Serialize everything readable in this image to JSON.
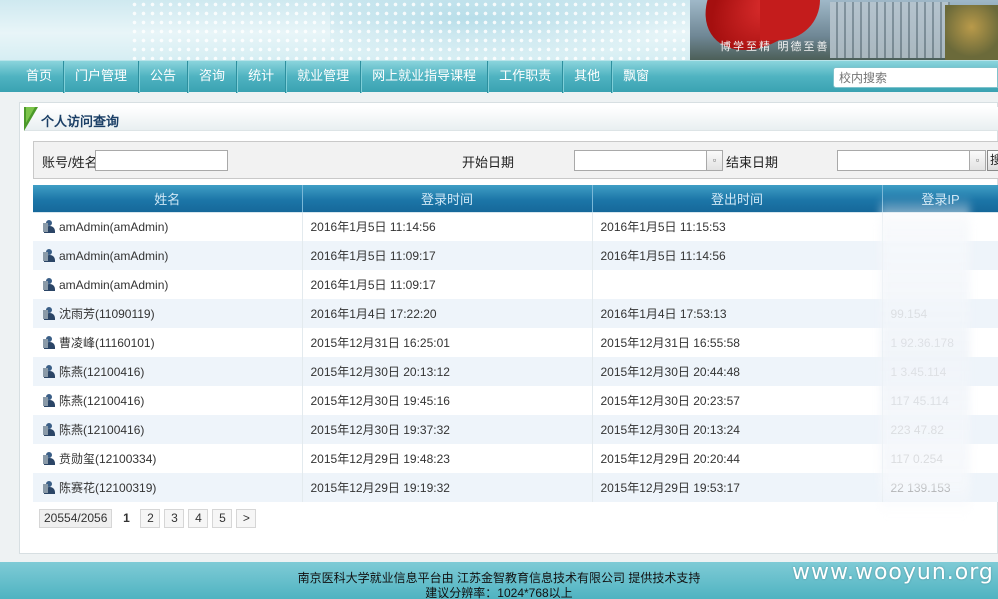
{
  "banner": {
    "calligraphy": "博学至精  明德至善"
  },
  "nav": {
    "items": [
      "首页",
      "门户管理",
      "公告",
      "咨询",
      "统计",
      "就业管理",
      "网上就业指导课程",
      "工作职责",
      "其他",
      "飘窗"
    ],
    "search_placeholder": "校内搜索"
  },
  "panel": {
    "title": "个人访问查询"
  },
  "filter": {
    "account_label": "账号/姓名",
    "account_value": "",
    "start_label": "开始日期",
    "start_value": "",
    "end_label": "结束日期",
    "end_value": "",
    "search_button": "搜"
  },
  "table": {
    "headers": [
      "姓名",
      "登录时间",
      "登出时间",
      "登录IP"
    ],
    "rows": [
      {
        "name": "amAdmin(amAdmin)",
        "login": "2016年1月5日 11:14:56",
        "logout": "2016年1月5日 11:15:53",
        "ip": ""
      },
      {
        "name": "amAdmin(amAdmin)",
        "login": "2016年1月5日 11:09:17",
        "logout": "2016年1月5日 11:14:56",
        "ip": ""
      },
      {
        "name": "amAdmin(amAdmin)",
        "login": "2016年1月5日 11:09:17",
        "logout": "",
        "ip": ""
      },
      {
        "name": "沈雨芳(11090119)",
        "login": "2016年1月4日 17:22:20",
        "logout": "2016年1月4日 17:53:13",
        "ip": "99.154"
      },
      {
        "name": "曹凌峰(11160101)",
        "login": "2015年12月31日 16:25:01",
        "logout": "2015年12月31日 16:55:58",
        "ip": "1    92.36.178"
      },
      {
        "name": "陈燕(12100416)",
        "login": "2015年12月30日 20:13:12",
        "logout": "2015年12月30日 20:44:48",
        "ip": "1    3.45.114"
      },
      {
        "name": "陈燕(12100416)",
        "login": "2015年12月30日 19:45:16",
        "logout": "2015年12月30日 20:23:57",
        "ip": "117    45.114"
      },
      {
        "name": "陈燕(12100416)",
        "login": "2015年12月30日 19:37:32",
        "logout": "2015年12月30日 20:13:24",
        "ip": "223    47.82"
      },
      {
        "name": "贲勋玺(12100334)",
        "login": "2015年12月29日 19:48:23",
        "logout": "2015年12月29日 20:20:44",
        "ip": "117    0.254"
      },
      {
        "name": "陈赛花(12100319)",
        "login": "2015年12月29日 19:19:32",
        "logout": "2015年12月29日 19:53:17",
        "ip": "22    139.153"
      }
    ]
  },
  "pager": {
    "info": "20554/2056",
    "pages": [
      "1",
      "2",
      "3",
      "4",
      "5",
      ">"
    ],
    "current": "1"
  },
  "footer": {
    "line1": "南京医科大学就业信息平台由 江苏金智教育信息技术有限公司 提供技术支持",
    "line2": "建议分辨率：1024*768以上"
  },
  "watermark": "www.wooyun.org"
}
